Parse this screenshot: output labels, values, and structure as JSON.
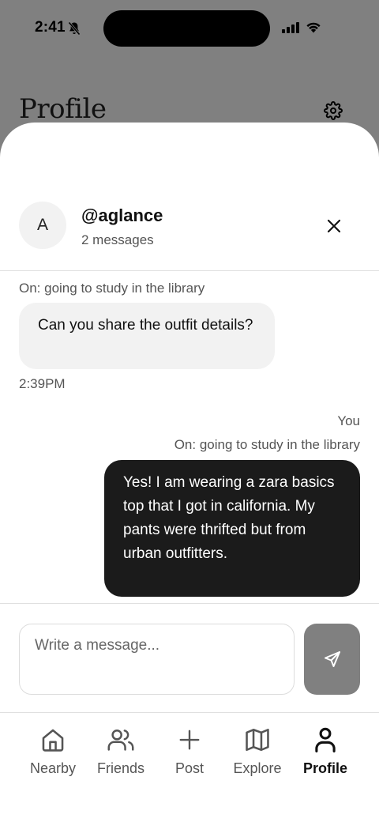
{
  "status_bar": {
    "time": "2:41"
  },
  "background": {
    "title": "Profile"
  },
  "chat_header": {
    "avatar_initial": "A",
    "username": "@aglance",
    "message_count": "2 messages"
  },
  "messages": [
    {
      "context": "On: going to study in the library",
      "text": "Can you share the outfit details?",
      "time": "2:39PM",
      "from": "other"
    },
    {
      "sender_label": "You",
      "context": "On: going to study in the library",
      "text": "Yes! I am wearing a zara basics top that I got in california. My pants were thrifted but from urban outfitters.",
      "from": "self"
    }
  ],
  "composer": {
    "placeholder": "Write a message...",
    "value": ""
  },
  "tabs": [
    {
      "label": "Nearby",
      "icon": "home-icon",
      "active": false
    },
    {
      "label": "Friends",
      "icon": "users-icon",
      "active": false
    },
    {
      "label": "Post",
      "icon": "plus-icon",
      "active": false
    },
    {
      "label": "Explore",
      "icon": "map-icon",
      "active": false
    },
    {
      "label": "Profile",
      "icon": "user-icon",
      "active": true
    }
  ],
  "colors": {
    "overlay": "#808080",
    "sheet": "#ffffff",
    "incoming_bubble": "#f2f2f2",
    "outgoing_bubble": "#1b1b1b",
    "send_button": "#808080"
  }
}
